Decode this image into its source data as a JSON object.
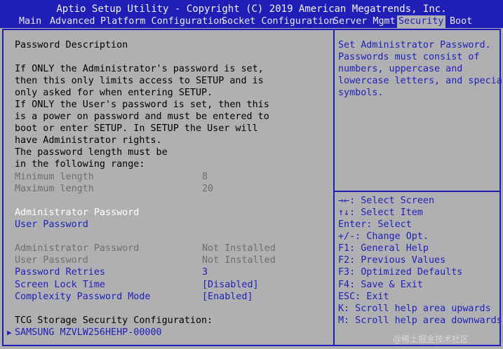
{
  "title": "Aptio Setup Utility - Copyright (C) 2019 American Megatrends, Inc.",
  "tabs": [
    "Main",
    "Advanced",
    "Platform Configuration",
    "Socket Configuration",
    "Server Mgmt",
    "Security",
    "Boot"
  ],
  "active_tab": "Security",
  "description": {
    "heading": "Password Description",
    "lines": [
      "If ONLY the Administrator's password is set,",
      "then this only limits access to SETUP and is",
      "only asked for when entering SETUP.",
      "If ONLY the User's password is set, then this",
      "is a power on password and must be entered to",
      "boot or enter SETUP. In SETUP the User will",
      "have Administrator rights.",
      "The password length must be",
      "in the following range:"
    ]
  },
  "range": {
    "min_label": "Minimum length",
    "min_value": "8",
    "max_label": "Maximum length",
    "max_value": "20"
  },
  "password_items": {
    "admin_password": "Administrator Password",
    "user_password": "User Password"
  },
  "status": {
    "admin_label": "Administrator Password",
    "admin_value": "Not Installed",
    "user_label": "User Password",
    "user_value": "Not Installed"
  },
  "settings": {
    "retries_label": "Password Retries",
    "retries_value": "3",
    "lock_label": "Screen Lock Time",
    "lock_value": "[Disabled]",
    "complexity_label": "Complexity Password Mode",
    "complexity_value": "[Enabled]"
  },
  "tcg": {
    "heading": "TCG Storage Security Configuration:",
    "device": "SAMSUNG MZVLW256HEHP-00000",
    "device_marker": "▶"
  },
  "help_text": [
    "Set Administrator Password.",
    "Passwords must consist of",
    "numbers, uppercase and",
    "lowercase letters, and special",
    "symbols."
  ],
  "keys": [
    "→←: Select Screen",
    "↑↓: Select Item",
    "Enter: Select",
    "+/-: Change Opt.",
    "F1: General Help",
    "F2: Previous Values",
    "F3: Optimized Defaults",
    "F4: Save & Exit",
    "ESC: Exit",
    "K: Scroll help area upwards",
    "M: Scroll help area downwards"
  ],
  "watermark": "@稀土掘金技术社区"
}
